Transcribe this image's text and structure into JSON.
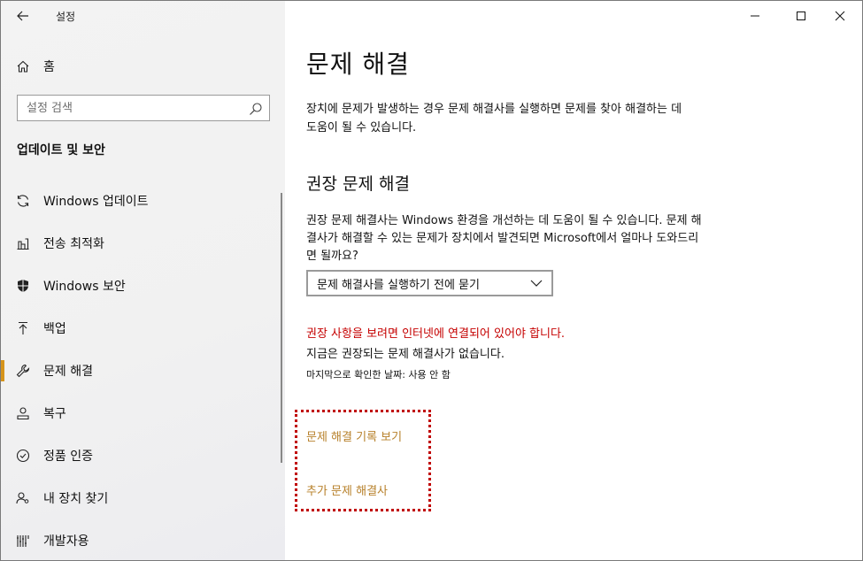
{
  "app": {
    "title": "설정",
    "back_label": "←"
  },
  "sidebar": {
    "home_label": "홈",
    "search_placeholder": "설정 검색",
    "section_title": "업데이트 및 보안",
    "items": [
      {
        "label": "Windows 업데이트",
        "icon": "sync-icon"
      },
      {
        "label": "전송 최적화",
        "icon": "delivery-optimization-icon"
      },
      {
        "label": "Windows 보안",
        "icon": "shield-icon"
      },
      {
        "label": "백업",
        "icon": "backup-arrow-icon"
      },
      {
        "label": "문제 해결",
        "icon": "wrench-icon",
        "active": true
      },
      {
        "label": "복구",
        "icon": "recovery-icon"
      },
      {
        "label": "정품 인증",
        "icon": "check-circle-icon"
      },
      {
        "label": "내 장치 찾기",
        "icon": "person-location-icon"
      },
      {
        "label": "개발자용",
        "icon": "developer-icon"
      }
    ]
  },
  "main": {
    "title": "문제 해결",
    "description": "장치에 문제가 발생하는 경우 문제 해결사를 실행하면 문제를 찾아 해결하는 데 도움이 될 수 있습니다.",
    "recommended_title": "권장 문제 해결",
    "recommended_description": "권장 문제 해결사는 Windows 환경을 개선하는 데 도움이 될 수 있습니다. 문제 해결사가 해결할 수 있는 문제가 장치에서 발견되면 Microsoft에서 얼마나 도와드리면 될까요?",
    "dropdown_value": "문제 해결사를 실행하기 전에 묻기",
    "warning": "권장 사항을 보려면 인터넷에 연결되어 있어야 합니다.",
    "no_recommendations": "지금은 권장되는 문제 해결사가 없습니다.",
    "last_checked": "마지막으로 확인한 날짜: 사용 안 함",
    "links": {
      "history": "문제 해결 기록 보기",
      "additional": "추가 문제 해결사"
    }
  },
  "colors": {
    "accent": "#d6941b",
    "link": "#b7802a",
    "warning": "#c50000",
    "highlight_border": "#c00000"
  }
}
